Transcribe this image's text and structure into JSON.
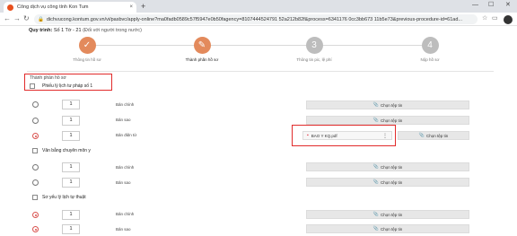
{
  "browser": {
    "tab_title": "Cổng dịch vụ công tỉnh Kon Tum",
    "tab_close": "×",
    "new_tab": "+",
    "url": "dichvucong.kontum.gov.vn/vi/pasbvc/apply-online?ma0fadb0589c57f5947e0b50fagency=8107444524791 52a212b82f&process=6341176 0cc3bb673 11b5e73&previous-procedure-id=61ad...",
    "lock": "🔒",
    "back": "←",
    "forward": "→",
    "reload": "↻",
    "minimize": "—",
    "maximize": "☐",
    "close": "✕"
  },
  "procedure": {
    "label": "Quy trình:",
    "value": "Số 1 Tờ - 21",
    "note": "(Đối với người trong nước)"
  },
  "steps": [
    {
      "label": "Thông tin hồ sơ",
      "status": "done",
      "glyph": "✓"
    },
    {
      "label": "Thành phần hồ sơ",
      "status": "current",
      "glyph": "✎"
    },
    {
      "label": "Thông tin pic, lệ phí",
      "status": "todo",
      "glyph": "3"
    },
    {
      "label": "Nộp hồ sơ",
      "status": "todo",
      "glyph": "4"
    }
  ],
  "section": {
    "title": "Thành phần hồ sơ"
  },
  "groups": [
    {
      "label": "Phiếu lý lịch tư pháp số 1"
    },
    {
      "label": "Văn bằng chuyên môn y"
    },
    {
      "label": "Sơ yếu lý lịch tự thuật"
    }
  ],
  "rows": [
    {
      "qty": "1",
      "type": "Bản chính",
      "button": "Chọn tệp tin",
      "selected": false
    },
    {
      "qty": "1",
      "type": "Bản sao",
      "button": "Chọn tệp tin",
      "selected": false
    },
    {
      "qty": "1",
      "type": "Bản điện tử",
      "button": "Chọn tệp tin",
      "selected": true
    },
    {
      "qty": "1",
      "type": "Bản chính",
      "button": "Chọn tệp tin",
      "selected": false
    },
    {
      "qty": "1",
      "type": "Bản sao",
      "button": "Chọn tệp tin",
      "selected": false
    },
    {
      "qty": "1",
      "type": "Bản chính",
      "button": "Chọn tệp tin",
      "selected": true
    },
    {
      "qty": "1",
      "type": "Bản sao",
      "button": "Chọn tệp tin",
      "selected": true
    }
  ],
  "uploaded_file": {
    "name": "BAO Y KQ.pdf",
    "icon": "pdf-icon"
  },
  "colors": {
    "accent": "#e38a5c",
    "highlight": "#e12b2b"
  }
}
